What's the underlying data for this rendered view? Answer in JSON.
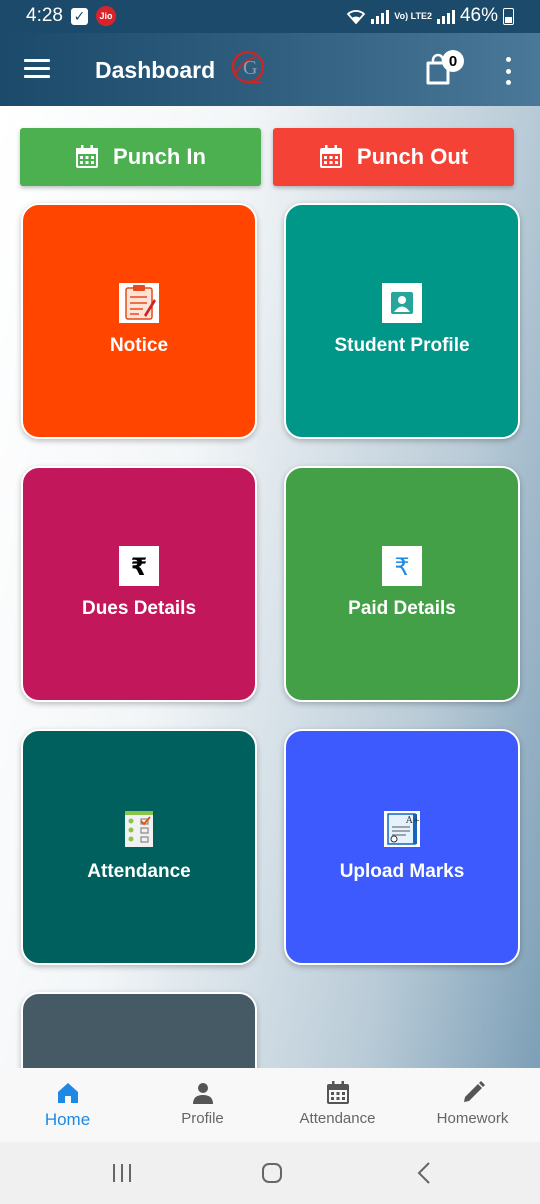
{
  "status_bar": {
    "time": "4:28",
    "carrier_icon": "jio-icon",
    "notification_icon": "checkbox-icon",
    "network_label": "Vo) LTE2",
    "battery": "46%"
  },
  "app_bar": {
    "title": "Dashboard",
    "logo": "G",
    "cart_count": "0",
    "menu_icon": "hamburger-menu-icon",
    "more_icon": "more-vert-icon"
  },
  "actions": {
    "punch_in": "Punch In",
    "punch_out": "Punch Out",
    "colors": {
      "punch_in": "#4caf50",
      "punch_out": "#f44336"
    }
  },
  "tiles": [
    {
      "label": "Notice",
      "color": "#ff4500",
      "icon": "clipboard-icon"
    },
    {
      "label": "Student Profile",
      "color": "#009688",
      "icon": "profile-card-icon"
    },
    {
      "label": "Dues Details",
      "color": "#c2185b",
      "icon": "rupee-icon"
    },
    {
      "label": "Paid Details",
      "color": "#43a047",
      "icon": "rupee-icon"
    },
    {
      "label": "Attendance",
      "color": "#00605e",
      "icon": "attendance-list-icon"
    },
    {
      "label": "Upload Marks",
      "color": "#3d5afe",
      "icon": "certificate-icon"
    },
    {
      "label": "",
      "color": "#455a64",
      "icon": ""
    }
  ],
  "bottom_nav": [
    {
      "label": "Home",
      "icon": "home-icon",
      "active": true
    },
    {
      "label": "Profile",
      "icon": "person-icon",
      "active": false
    },
    {
      "label": "Attendance",
      "icon": "calendar-icon",
      "active": false
    },
    {
      "label": "Homework",
      "icon": "pencil-icon",
      "active": false
    }
  ],
  "accent_color": "#1e88e5"
}
